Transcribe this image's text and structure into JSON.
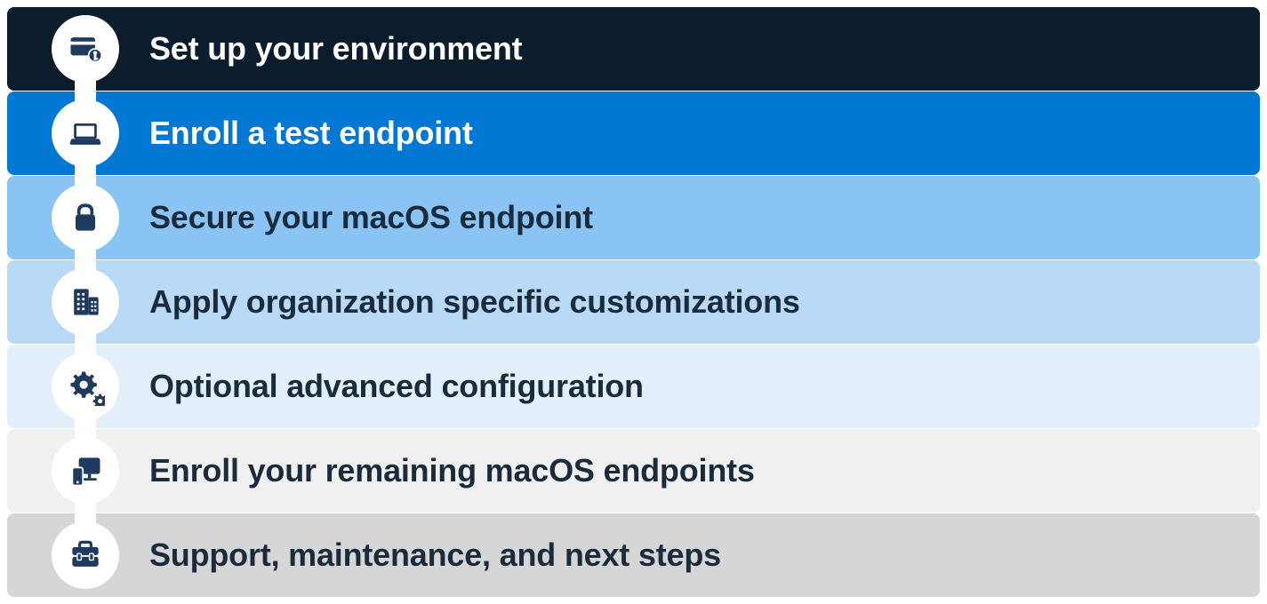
{
  "steps": [
    {
      "label": "Set up your environment",
      "icon": "card-key-icon"
    },
    {
      "label": "Enroll a test endpoint",
      "icon": "laptop-icon"
    },
    {
      "label": "Secure your macOS endpoint",
      "icon": "lock-icon"
    },
    {
      "label": "Apply organization specific customizations",
      "icon": "building-icon"
    },
    {
      "label": "Optional advanced configuration",
      "icon": "gears-icon"
    },
    {
      "label": "Enroll your remaining macOS endpoints",
      "icon": "devices-icon"
    },
    {
      "label": "Support, maintenance, and next steps",
      "icon": "toolbox-icon"
    }
  ]
}
